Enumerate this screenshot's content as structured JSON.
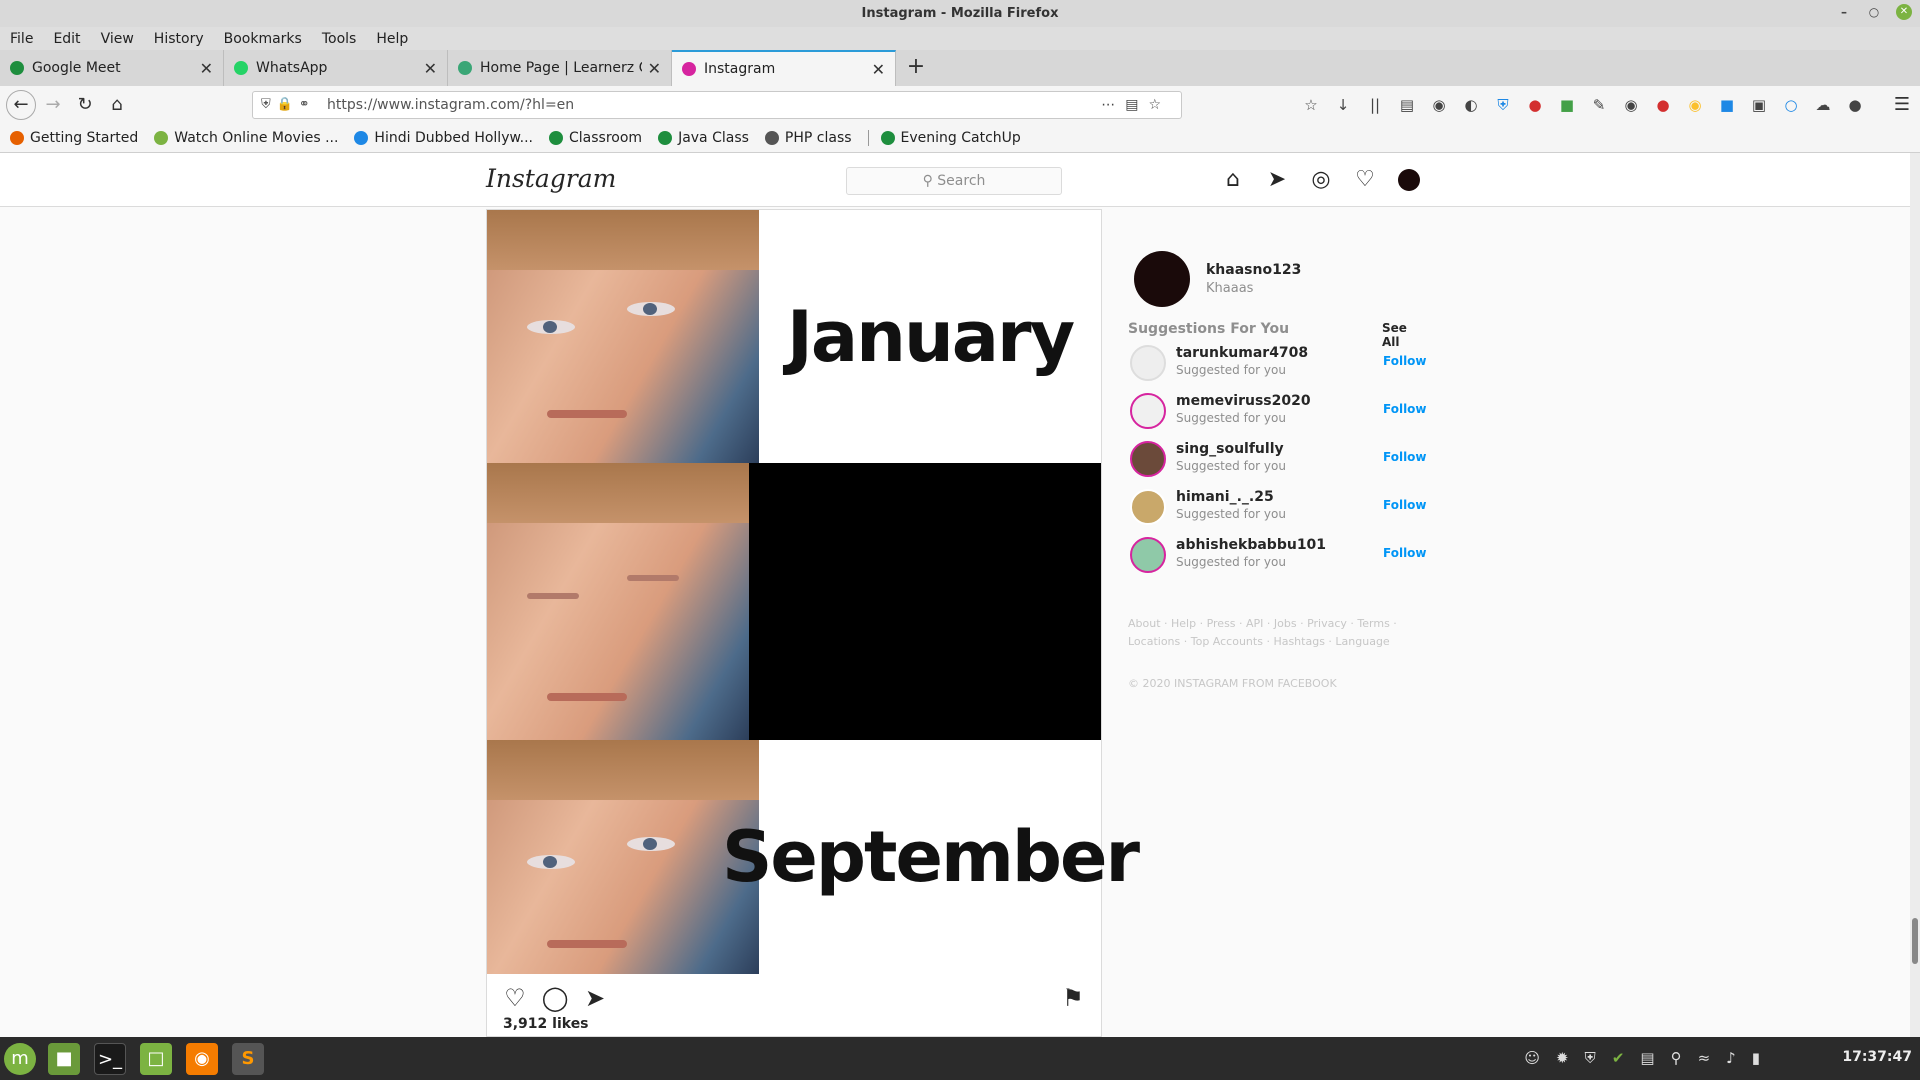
{
  "window": {
    "title": "Instagram - Mozilla Firefox"
  },
  "menu": [
    "File",
    "Edit",
    "View",
    "History",
    "Bookmarks",
    "Tools",
    "Help"
  ],
  "tabs": [
    {
      "label": "Google Meet",
      "color": "#1e8e3e"
    },
    {
      "label": "WhatsApp",
      "color": "#25d366"
    },
    {
      "label": "Home Page | Learnerz Corn",
      "color": "#3aa676"
    },
    {
      "label": "Instagram",
      "color": "#d6249f"
    }
  ],
  "url": "https://www.instagram.com/?hl=en",
  "bookmarks": [
    {
      "label": "Getting Started",
      "color": "#e66000"
    },
    {
      "label": "Watch Online Movies ...",
      "color": "#7cb342"
    },
    {
      "label": "Hindi Dubbed Hollyw...",
      "color": "#1e88e5"
    },
    {
      "label": "Classroom",
      "color": "#1e8e3e"
    },
    {
      "label": "Java Class",
      "color": "#1e8e3e"
    },
    {
      "label": "PHP class",
      "color": "#555555"
    },
    {
      "label": "Evening CatchUp",
      "color": "#1e8e3e"
    }
  ],
  "instagram": {
    "logo": "Instagram",
    "search_placeholder": "Search",
    "post": {
      "captions": [
        "January",
        "",
        "September"
      ],
      "likes": "3,912 likes"
    },
    "profile": {
      "username": "khaasno123",
      "name": "Khaaas"
    },
    "suggestions_title": "Suggestions For You",
    "see_all": "See All",
    "suggestions": [
      {
        "username": "tarunkumar4708",
        "sub": "Suggested for you",
        "action": "Follow"
      },
      {
        "username": "memeviruss2020",
        "sub": "Suggested for you",
        "action": "Follow"
      },
      {
        "username": "sing_soulfully",
        "sub": "Suggested for you",
        "action": "Follow"
      },
      {
        "username": "himani_._.25",
        "sub": "Suggested for you",
        "action": "Follow"
      },
      {
        "username": "abhishekbabbu101",
        "sub": "Suggested for you",
        "action": "Follow"
      }
    ],
    "footer_links_1": "About · Help · Press · API · Jobs · Privacy · Terms ·",
    "footer_links_2": "Locations · Top Accounts · Hashtags · Language",
    "copyright": "© 2020 INSTAGRAM FROM FACEBOOK"
  },
  "taskbar": {
    "clock": "17:37:47"
  },
  "colors": {
    "accent": "#0095f6",
    "tab_active": "#2b9bd8"
  }
}
